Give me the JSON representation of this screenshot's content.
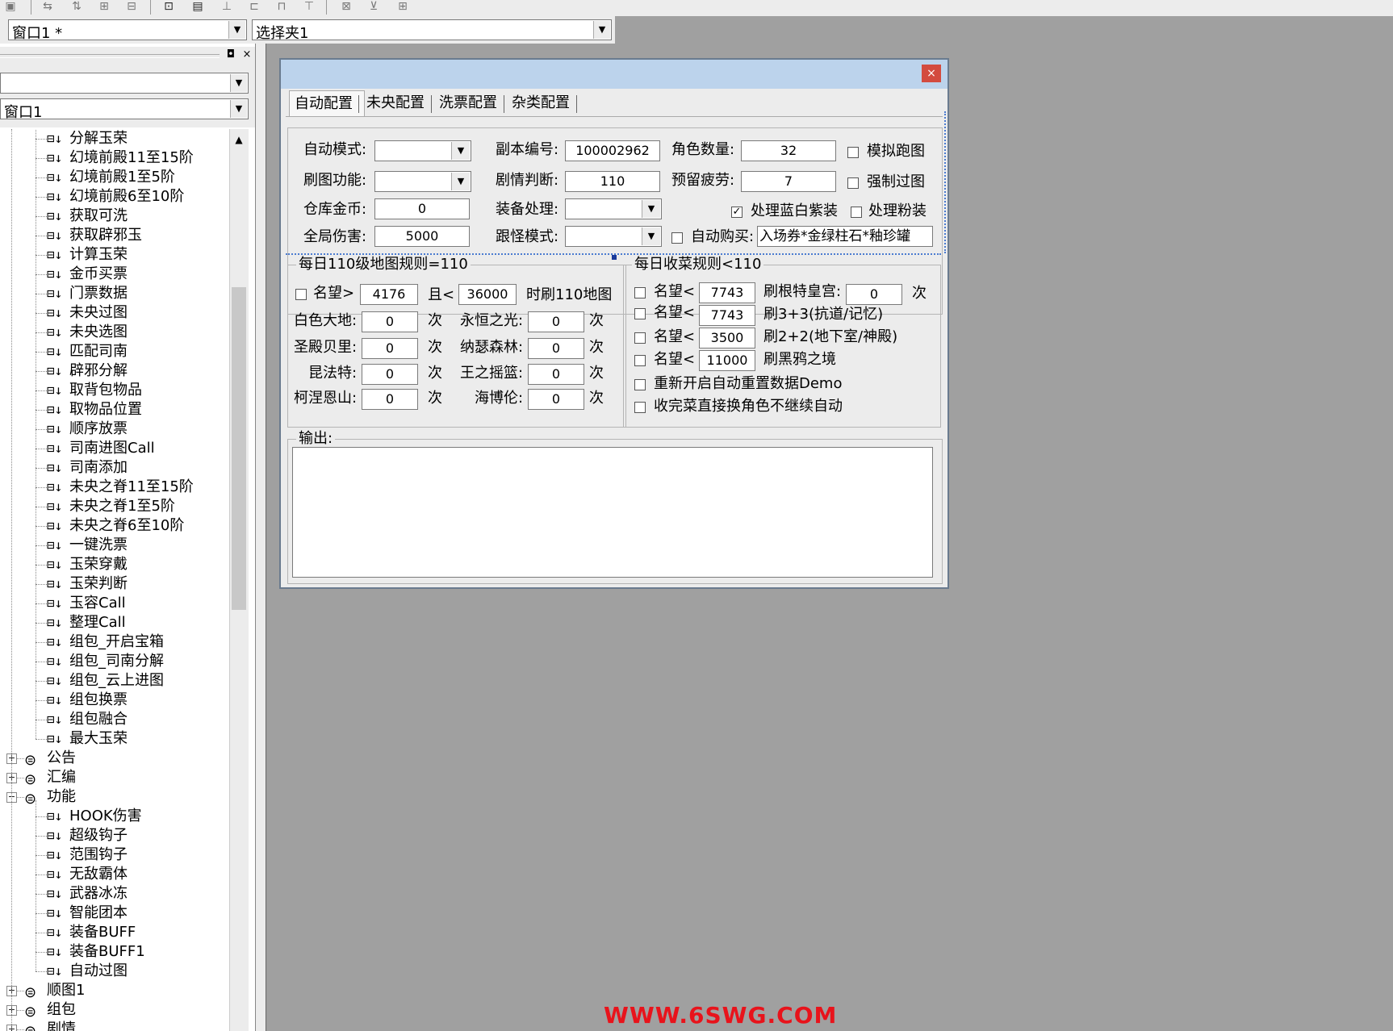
{
  "toolbar": {
    "icons": [
      "window-icon",
      "layout-icon",
      "align-icon",
      "spacing-icon",
      "grid-icon",
      "frame-icon",
      "form-icon",
      "center-icon",
      "size-icon",
      "width-icon",
      "height-icon",
      "tab-order-icon"
    ]
  },
  "top_combos": {
    "window": "窗口1 *",
    "selector": "选择夹1"
  },
  "left_panel": {
    "combo1": "",
    "combo2": "窗口1",
    "tree": {
      "group_a_items": [
        "分解玉荣",
        "幻境前殿11至15阶",
        "幻境前殿1至5阶",
        "幻境前殿6至10阶",
        "获取可洗",
        "获取辟邪玉",
        "计算玉荣",
        "金币买票",
        "门票数据",
        "未央过图",
        "未央选图",
        "匹配司南",
        "辟邪分解",
        "取背包物品",
        "取物品位置",
        "顺序放票",
        "司南进图Call",
        "司南添加",
        "未央之脊11至15阶",
        "未央之脊1至5阶",
        "未央之脊6至10阶",
        "一键洗票",
        "玉荣穿戴",
        "玉荣判断",
        "玉容Call",
        "整理Call",
        "组包_开启宝箱",
        "组包_司南分解",
        "组包_云上进图",
        "组包换票",
        "组包融合",
        "最大玉荣"
      ],
      "folder_gonggao": "公告",
      "folder_huibian": "汇编",
      "folder_gongneng": "功能",
      "gongneng_items": [
        "HOOK伤害",
        "超级钩子",
        "范围钩子",
        "无敌霸体",
        "武器冰冻",
        "智能团本",
        "装备BUFF",
        "装备BUFF1",
        "自动过图"
      ],
      "folder_shuntu": "顺图1",
      "folder_zubao": "组包",
      "folder_juqing": "剧情"
    }
  },
  "dialog": {
    "close": "×",
    "tabs": [
      "自动配置",
      "未央配置",
      "洗票配置",
      "杂类配置"
    ],
    "auto_mode_label": "自动模式:",
    "auto_mode_value": "",
    "map_func_label": "刷图功能:",
    "map_func_value": "",
    "gold_label": "仓库金币:",
    "gold_value": "0",
    "damage_label": "全局伤害:",
    "damage_value": "5000",
    "dungeon_id_label": "副本编号:",
    "dungeon_id_value": "100002962",
    "story_label": "剧情判断:",
    "story_value": "110",
    "equip_label": "装备处理:",
    "equip_value": "",
    "follow_label": "跟怪模式:",
    "follow_value": "",
    "role_count_label": "角色数量:",
    "role_count_value": "32",
    "fatigue_label": "预留疲劳:",
    "fatigue_value": "7",
    "sim_run_label": "模拟跑图",
    "sim_run_checked": false,
    "force_label": "强制过图",
    "force_checked": false,
    "blue_label": "处理蓝白紫装",
    "blue_checked": true,
    "pink_label": "处理粉装",
    "pink_checked": false,
    "autobuy_label": "自动购买:",
    "autobuy_checked": false,
    "autobuy_value": "入场券*金绿柱石*釉珍罐",
    "daily110": {
      "title": "每日110级地图规则=110",
      "fame_label": "名望>",
      "fame_value": "4176",
      "and_label": "且<",
      "and_value": "36000",
      "suffix": "时刷110地图",
      "times": "次",
      "rows_left": [
        {
          "label": "白色大地:",
          "value": "0"
        },
        {
          "label": "圣殿贝里:",
          "value": "0"
        },
        {
          "label": "昆法特:",
          "value": "0"
        },
        {
          "label": "柯涅恩山:",
          "value": "0"
        }
      ],
      "rows_right": [
        {
          "label": "永恒之光:",
          "value": "0"
        },
        {
          "label": "纳瑟森林:",
          "value": "0"
        },
        {
          "label": "王之摇篮:",
          "value": "0"
        },
        {
          "label": "海博伦:",
          "value": "0"
        }
      ]
    },
    "harvest": {
      "title": "每日收菜规则<110",
      "fame_label": "名望<",
      "times": "次",
      "rows": [
        {
          "value": "7743",
          "action": "刷根特皇宫:",
          "count": "0"
        },
        {
          "value": "7743",
          "action": "刷3+3(抗道/记忆)"
        },
        {
          "value": "3500",
          "action": "刷2+2(地下室/神殿)"
        },
        {
          "value": "11000",
          "action": "刷黑鸦之境"
        }
      ],
      "restart_label": "重新开启自动重置数据Demo",
      "switch_label": "收完菜直接换角色不继续自动"
    },
    "output_label": "输出:",
    "output_text": ""
  },
  "watermark": "WWW.6SWG.COM",
  "colors": {
    "desktop": "#a0a0a0",
    "dialog_bg": "#ececec",
    "title_bar": "#bcd3ec",
    "close_button": "#d34b3f",
    "watermark": "#e8131b",
    "guide_dots": "#4a7bd0"
  }
}
